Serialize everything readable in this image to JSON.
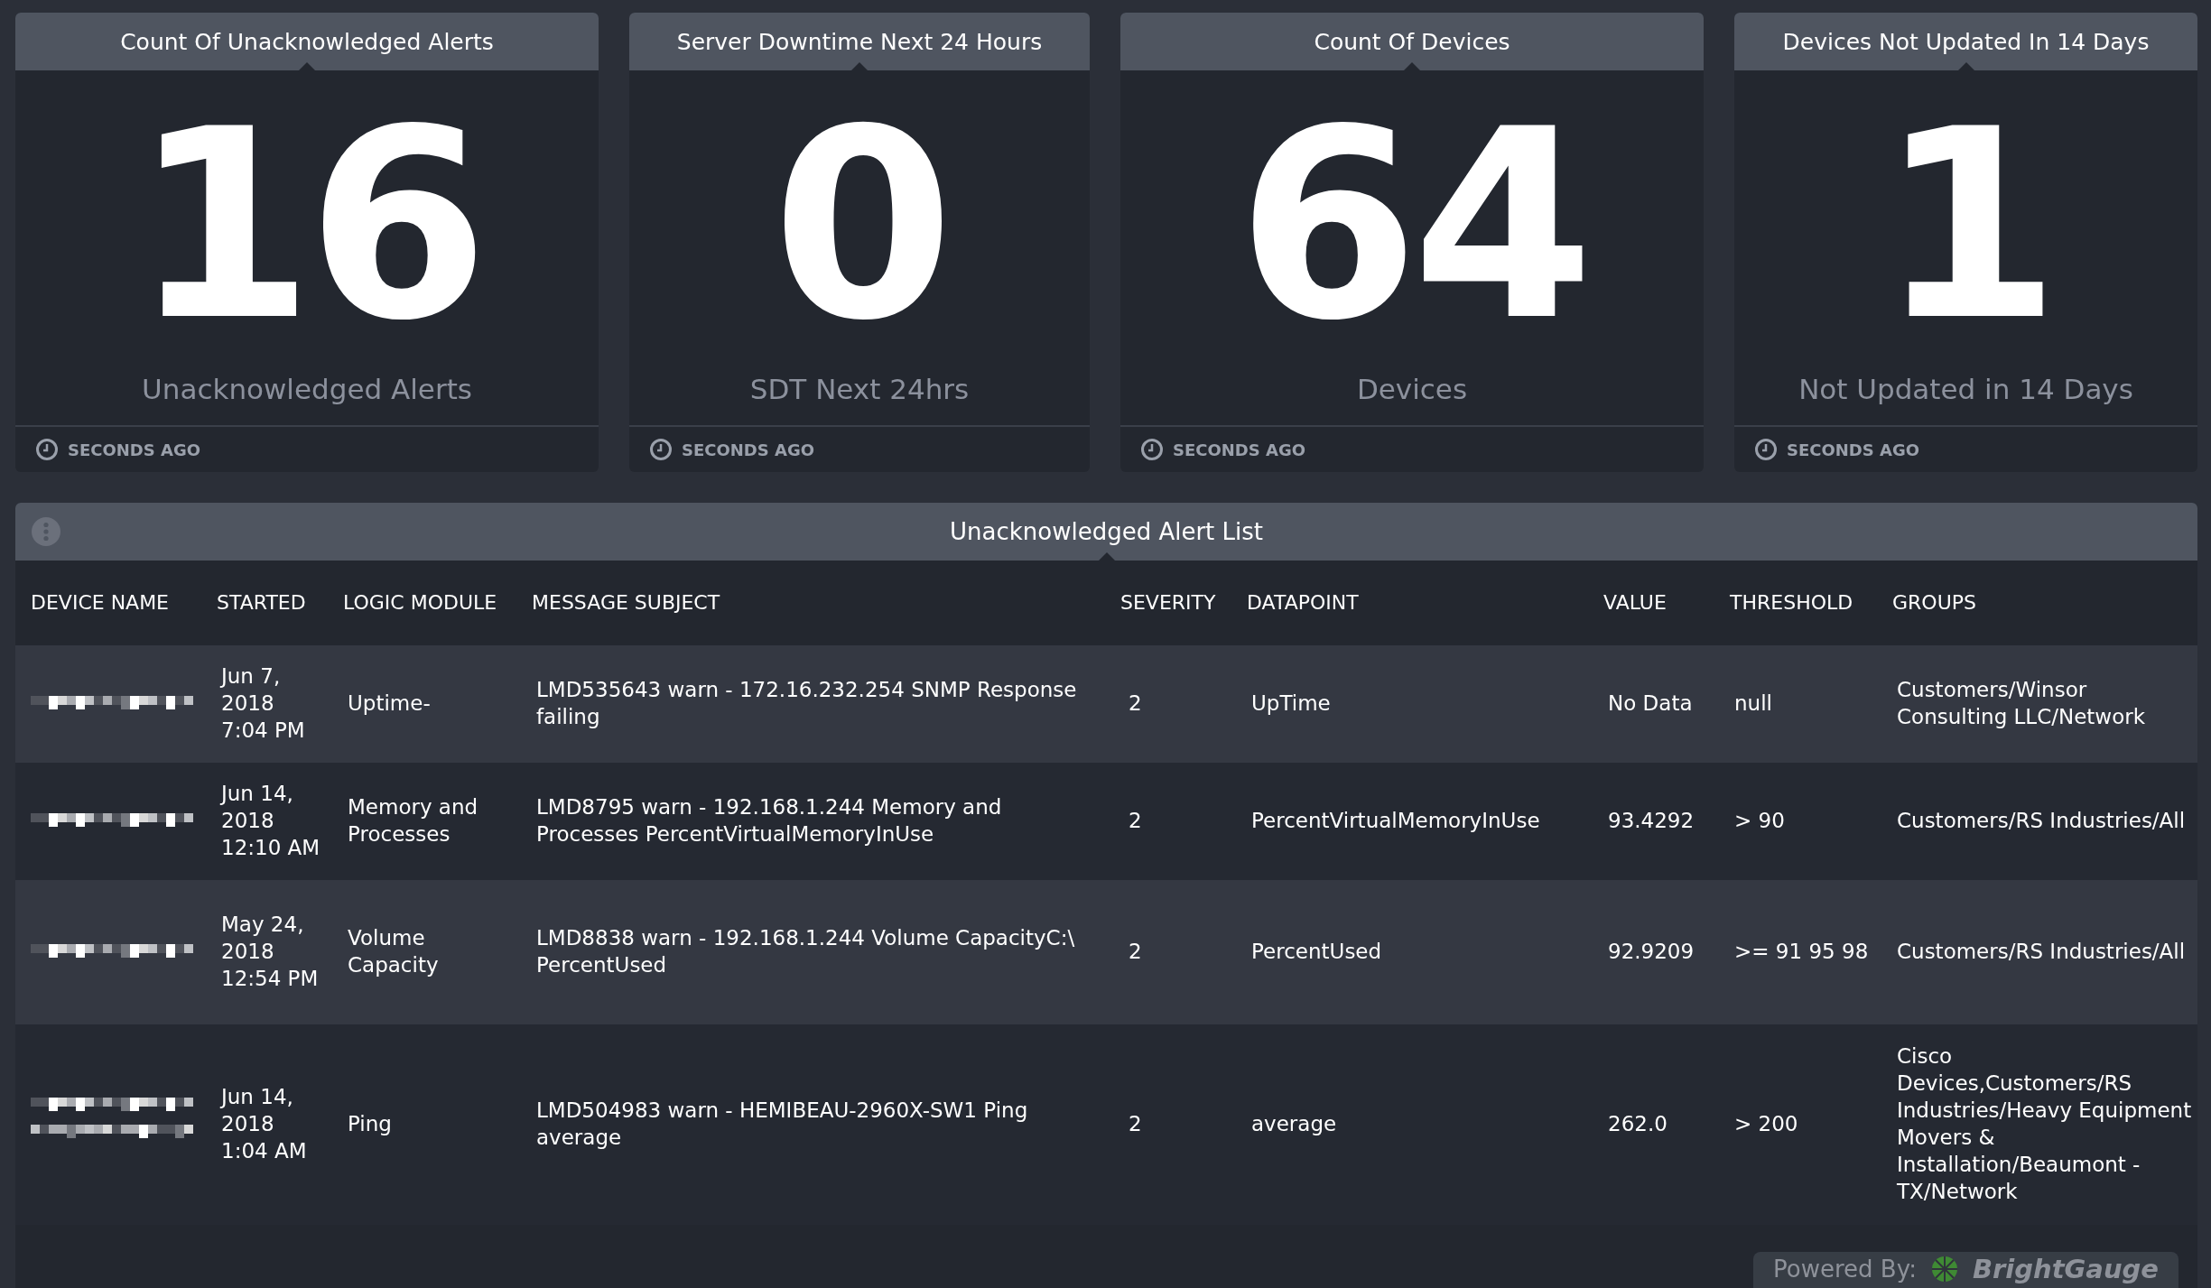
{
  "cards": [
    {
      "title": "Count Of Unacknowledged Alerts",
      "value": "16",
      "caption": "Unacknowledged Alerts",
      "updated": "SECONDS AGO"
    },
    {
      "title": "Server Downtime Next 24 Hours",
      "value": "0",
      "caption": "SDT Next 24hrs",
      "updated": "SECONDS AGO"
    },
    {
      "title": "Count Of Devices",
      "value": "64",
      "caption": "Devices",
      "updated": "SECONDS AGO"
    },
    {
      "title": "Devices Not Updated In 14 Days",
      "value": "1",
      "caption": "Not Updated in 14 Days",
      "updated": "SECONDS AGO"
    }
  ],
  "alert_list": {
    "title": "Unacknowledged Alert List",
    "columns": [
      "DEVICE NAME",
      "STARTED",
      "LOGIC MODULE",
      "MESSAGE SUBJECT",
      "SEVERITY",
      "DATAPOINT",
      "VALUE",
      "THRESHOLD",
      "GROUPS"
    ],
    "rows": [
      {
        "device": {
          "kind": "redacted"
        },
        "started": "Jun 7, 2018 7:04 PM",
        "logic_module": "Uptime-",
        "message_subject": "LMD535643 warn - 172.16.232.254 SNMP Response failing",
        "severity": "2",
        "datapoint": "UpTime",
        "value": "No Data",
        "threshold": "null",
        "groups": "Customers/Winsor Consulting LLC/Network"
      },
      {
        "device": {
          "kind": "redacted"
        },
        "started": "Jun 14, 2018 12:10 AM",
        "logic_module": "Memory and Processes",
        "message_subject": "LMD8795 warn - 192.168.1.244 Memory and Processes PercentVirtualMemoryInUse",
        "severity": "2",
        "datapoint": "PercentVirtualMemoryInUse",
        "value": "93.4292",
        "threshold": "> 90",
        "groups": "Customers/RS Industries/All"
      },
      {
        "device": {
          "kind": "redacted"
        },
        "started": "May 24, 2018 12:54 PM",
        "logic_module": "Volume Capacity",
        "message_subject": "LMD8838 warn - 192.168.1.244 Volume CapacityC:\\ PercentUsed",
        "severity": "2",
        "datapoint": "PercentUsed",
        "value": "92.9209",
        "threshold": ">= 91 95 98",
        "groups": "Customers/RS Industries/All"
      },
      {
        "device": {
          "kind": "redacted_two_line"
        },
        "started": "Jun 14, 2018 1:04 AM",
        "logic_module": "Ping",
        "message_subject": "LMD504983 warn - HEMIBEAU-2960X-SW1 Ping average",
        "severity": "2",
        "datapoint": "average",
        "value": "262.0",
        "threshold": "> 200",
        "groups": "Cisco Devices,Customers/RS Industries/Heavy Equipment Movers & Installation/Beaumont - TX/Network"
      }
    ]
  },
  "powered_by": {
    "label": "Powered By:",
    "brand": "BrightGauge"
  }
}
